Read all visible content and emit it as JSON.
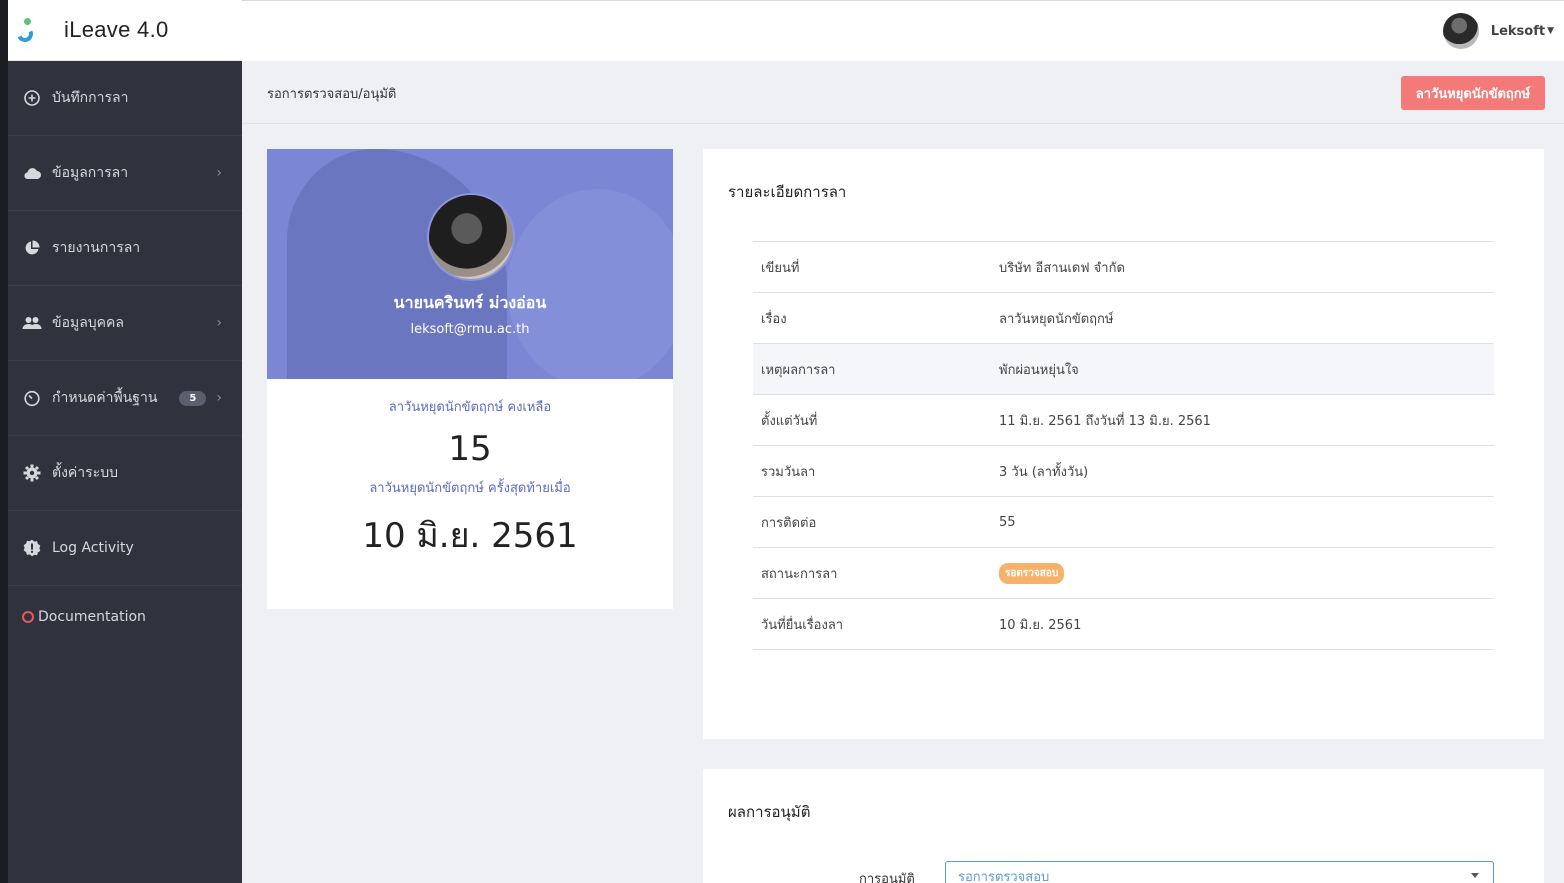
{
  "app": {
    "title": "iLeave  4.0"
  },
  "sidebar": {
    "items": [
      {
        "label": "บันทึกการลา",
        "icon": "add-circle-icon",
        "has_submenu": false
      },
      {
        "label": "ข้อมูลการลา",
        "icon": "cloud-icon",
        "has_submenu": true
      },
      {
        "label": "รายงานการลา",
        "icon": "pie-chart-icon",
        "has_submenu": false
      },
      {
        "label": "ข้อมูลบุคคล",
        "icon": "people-icon",
        "has_submenu": true
      },
      {
        "label": "กำหนดค่าพื้นฐาน",
        "icon": "timer-icon",
        "has_submenu": true,
        "badge": "5"
      },
      {
        "label": "ตั้งค่าระบบ",
        "icon": "gear-icon",
        "has_submenu": false
      },
      {
        "label": "Log Activity",
        "icon": "alert-icon",
        "has_submenu": false
      }
    ],
    "documentation": "Documentation"
  },
  "topbar": {
    "username": "Leksoft"
  },
  "page": {
    "title": "รอการตรวจสอบ/อนุมัติ",
    "header_button": "ลาวันหยุดนักขัตฤกษ์"
  },
  "profile": {
    "name": "นายนครินทร์ ม่วงอ่อน",
    "email": "leksoft@rmu.ac.th",
    "quota_label": "ลาวันหยุดนักขัตฤกษ์ คงเหลือ",
    "quota_value": "15",
    "last_label": "ลาวันหยุดนักขัตฤกษ์ ครั้งสุดท้ายเมื่อ",
    "last_value": "10 มิ.ย. 2561"
  },
  "detail": {
    "title": "รายละเอียดการลา",
    "rows": [
      {
        "key": "เขียนที่",
        "value": "บริษัท อีสานเดฟ จำกัด"
      },
      {
        "key": "เรื่อง",
        "value": "ลาวันหยุดนักขัตฤกษ์"
      },
      {
        "key": "เหตุผลการลา",
        "value": "พักผ่อนหยุ่นใจ"
      },
      {
        "key": "ตั้งแต่วันที่",
        "value": "11 มิ.ย. 2561 ถึงวันที่ 13 มิ.ย. 2561"
      },
      {
        "key": "รวมวันลา",
        "value": "3 วัน (ลาทั้งวัน)"
      },
      {
        "key": "การติดต่อ",
        "value": "55"
      },
      {
        "key": "สถานะการลา",
        "value": "รอตรวจสอบ"
      },
      {
        "key": "วันที่ยื่นเรื่องลา",
        "value": "10 มิ.ย. 2561"
      }
    ]
  },
  "approval": {
    "title": "ผลการอนุมัติ",
    "field_label": "การอนุมัติ",
    "selected": "รอการตรวจสอบ"
  },
  "colors": {
    "sidebar_bg": "#30323d",
    "accent_button": "#f47a7a",
    "hero_bg": "#7b86d4",
    "link_text": "#5b6bc0",
    "status_badge": "#f6b26b"
  }
}
